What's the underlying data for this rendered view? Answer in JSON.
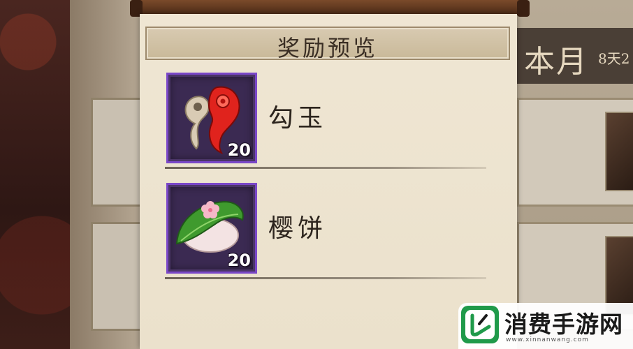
{
  "dialog": {
    "title": "奖励预览",
    "rewards": [
      {
        "name": "勾玉",
        "count": "20",
        "icon": "magatama-icon"
      },
      {
        "name": "樱饼",
        "count": "20",
        "icon": "sakura-mochi-icon"
      }
    ]
  },
  "background": {
    "header_text": "本月",
    "header_sub": "8天2"
  },
  "watermark": {
    "brand": "消费手游网",
    "url": "www.xinnanwang.com"
  },
  "colors": {
    "item_frame_border": "#7a47c8",
    "parchment": "#efe6d3",
    "brand_green": "#1f9a4a"
  }
}
